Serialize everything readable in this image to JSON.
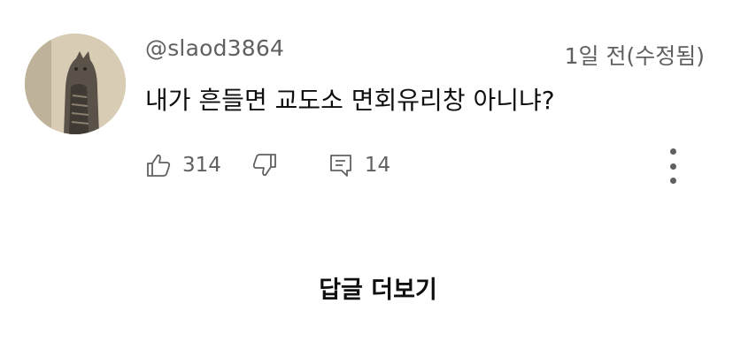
{
  "comment": {
    "username": "@slaod3864",
    "timestamp": "1일 전(수정됨)",
    "text": "내가 흔들면 교도소 면회유리창 아니냐?",
    "avatar_icon": "cat-photo-avatar",
    "likes": "314",
    "replies_count": "14"
  },
  "actions": {
    "like_icon": "thumbs-up-icon",
    "dislike_icon": "thumbs-down-icon",
    "reply_icon": "reply-comment-icon",
    "more_icon": "more-vertical-icon"
  },
  "more_replies_label": "답글 더보기",
  "colors": {
    "primary_text": "#0f0f0f",
    "secondary_text": "#606060",
    "background": "#ffffff"
  }
}
